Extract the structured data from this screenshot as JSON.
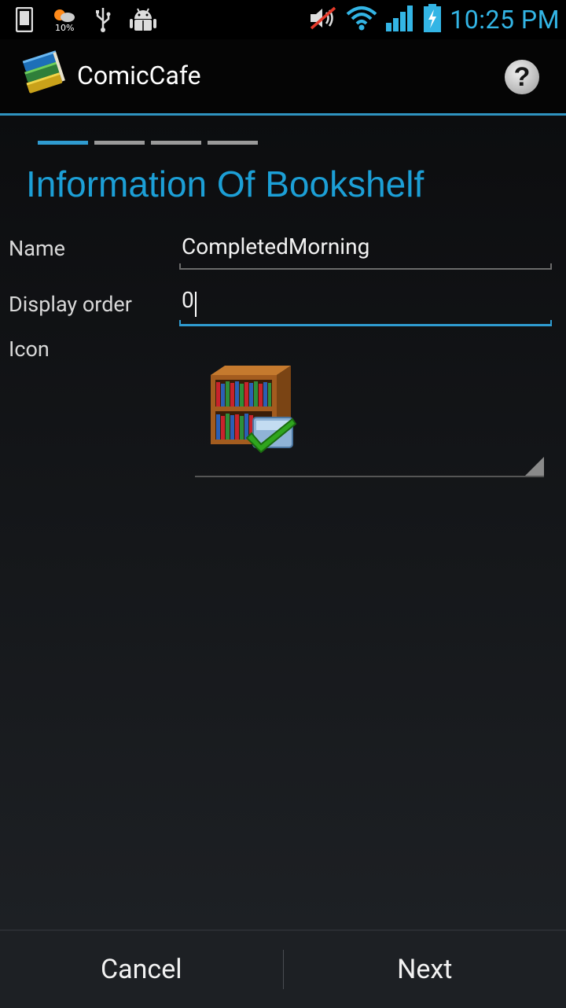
{
  "status_bar": {
    "time": "10:25 PM",
    "weather_text": "10%",
    "icons": [
      "phone-icon",
      "weather-icon",
      "usb-icon",
      "android-debug-icon",
      "mute-icon",
      "wifi-icon",
      "signal-icon",
      "battery-charging-icon"
    ],
    "accent_color": "#33b5e5"
  },
  "action_bar": {
    "title": "ComicCafe",
    "help_label": "?"
  },
  "wizard": {
    "steps_total": 4,
    "current_step": 1
  },
  "form": {
    "heading": "Information Of Bookshelf",
    "name_label": "Name",
    "name_value": "CompletedMorning",
    "order_label": "Display order",
    "order_value": "0",
    "icon_label": "Icon",
    "icon_choice": "bookshelf-check-icon"
  },
  "buttons": {
    "cancel": "Cancel",
    "next": "Next"
  },
  "colors": {
    "accent": "#2f9bd0",
    "heading": "#1c9fd6",
    "background": "#16181b"
  }
}
